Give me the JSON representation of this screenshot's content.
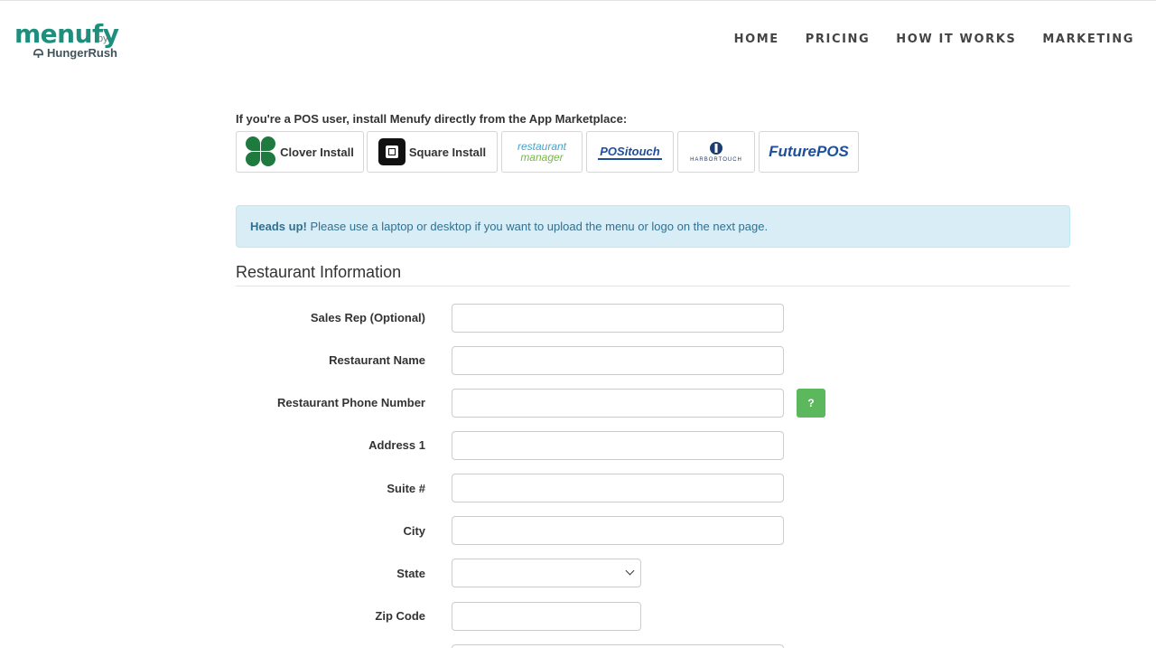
{
  "brand": {
    "logo_text": "menufy",
    "by_text": "by",
    "partner_text": "HungerRush",
    "primary_color": "#1e8f7c"
  },
  "nav": {
    "items": [
      "HOME",
      "PRICING",
      "HOW IT WORKS",
      "MARKETING"
    ]
  },
  "pos": {
    "title": "If you're a POS user, install Menufy directly from the App Marketplace:",
    "clover_label": "Clover Install",
    "square_label": "Square Install",
    "logos": {
      "restaurant_manager_1": "restaurant",
      "restaurant_manager_2": "manager",
      "positouch": "POSitouch",
      "harbortouch": "HARBORTOUCH",
      "futurepos": "FuturePOS"
    }
  },
  "alert": {
    "strong": "Heads up!",
    "text": " Please use a laptop or desktop if you want to upload the menu or logo on the next page."
  },
  "section": {
    "title": "Restaurant Information"
  },
  "form": {
    "sales_rep": "Sales Rep (Optional)",
    "restaurant_name": "Restaurant Name",
    "phone": "Restaurant Phone Number",
    "address1": "Address 1",
    "suite": "Suite #",
    "city": "City",
    "state": "State",
    "zip": "Zip Code",
    "help_label": "?"
  },
  "colors": {
    "alert_bg": "#d9edf7",
    "alert_text": "#31708f",
    "help_button": "#5cb85c"
  }
}
